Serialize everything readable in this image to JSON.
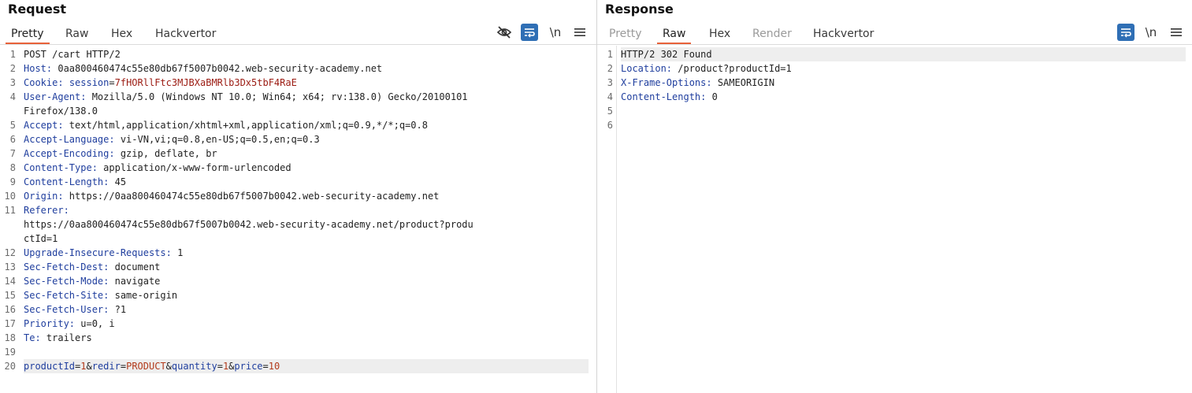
{
  "request": {
    "title": "Request",
    "tabs": [
      "Pretty",
      "Raw",
      "Hex",
      "Hackvertor"
    ],
    "active_tab": "Pretty",
    "toolbar": {
      "hide_icon": "eye-off-icon",
      "wrap_icon": "wrap-lines-icon",
      "newline_label": "\\n",
      "menu_icon": "hamburger-menu-icon"
    },
    "lines": [
      {
        "n": "1",
        "text": "POST /cart HTTP/2"
      },
      {
        "n": "2",
        "key": "Host",
        "val": "0aa800460474c55e80db67f5007b0042.web-security-academy.net"
      },
      {
        "n": "3",
        "key": "Cookie",
        "ckey": "session",
        "cval": "7fHORllFtc3MJBXaBMRlb3Dx5tbF4RaE"
      },
      {
        "n": "4",
        "key": "User-Agent",
        "val": "Mozilla/5.0 (Windows NT 10.0; Win64; x64; rv:138.0) Gecko/20100101"
      },
      {
        "n": "",
        "text": "Firefox/138.0"
      },
      {
        "n": "5",
        "key": "Accept",
        "val": "text/html,application/xhtml+xml,application/xml;q=0.9,*/*;q=0.8"
      },
      {
        "n": "6",
        "key": "Accept-Language",
        "val": "vi-VN,vi;q=0.8,en-US;q=0.5,en;q=0.3"
      },
      {
        "n": "7",
        "key": "Accept-Encoding",
        "val": "gzip, deflate, br"
      },
      {
        "n": "8",
        "key": "Content-Type",
        "val": "application/x-www-form-urlencoded"
      },
      {
        "n": "9",
        "key": "Content-Length",
        "val": "45"
      },
      {
        "n": "10",
        "key": "Origin",
        "val": "https://0aa800460474c55e80db67f5007b0042.web-security-academy.net"
      },
      {
        "n": "11",
        "key": "Referer",
        "val": ""
      },
      {
        "n": "",
        "text": "https://0aa800460474c55e80db67f5007b0042.web-security-academy.net/product?produ"
      },
      {
        "n": "",
        "text": "ctId=1"
      },
      {
        "n": "12",
        "key": "Upgrade-Insecure-Requests",
        "val": "1"
      },
      {
        "n": "13",
        "key": "Sec-Fetch-Dest",
        "val": "document"
      },
      {
        "n": "14",
        "key": "Sec-Fetch-Mode",
        "val": "navigate"
      },
      {
        "n": "15",
        "key": "Sec-Fetch-Site",
        "val": "same-origin"
      },
      {
        "n": "16",
        "key": "Sec-Fetch-User",
        "val": "?1"
      },
      {
        "n": "17",
        "key": "Priority",
        "val": "u=0, i"
      },
      {
        "n": "18",
        "key": "Te",
        "val": "trailers"
      },
      {
        "n": "19",
        "text": ""
      },
      {
        "n": "20",
        "params": [
          [
            "productId",
            "1"
          ],
          [
            "redir",
            "PRODUCT"
          ],
          [
            "quantity",
            "1"
          ],
          [
            "price",
            "10"
          ]
        ],
        "highlight": true
      }
    ]
  },
  "response": {
    "title": "Response",
    "tabs": [
      "Pretty",
      "Raw",
      "Hex",
      "Render",
      "Hackvertor"
    ],
    "active_tab": "Raw",
    "disabled_tabs": [
      "Pretty",
      "Render"
    ],
    "toolbar": {
      "wrap_icon": "wrap-lines-icon",
      "newline_label": "\\n",
      "menu_icon": "hamburger-menu-icon"
    },
    "lines": [
      {
        "n": "1",
        "text": "HTTP/2 302 Found",
        "highlight": true
      },
      {
        "n": "2",
        "key": "Location",
        "val": "/product?productId=1"
      },
      {
        "n": "3",
        "key": "X-Frame-Options",
        "val": "SAMEORIGIN"
      },
      {
        "n": "4",
        "key": "Content-Length",
        "val": "0"
      },
      {
        "n": "5",
        "text": ""
      },
      {
        "n": "6",
        "text": ""
      }
    ]
  },
  "colors": {
    "accent": "#e8623a",
    "tool_blue": "#2f6fb5",
    "header_key": "#1f3e9e",
    "cookie_value": "#9b1b12"
  }
}
